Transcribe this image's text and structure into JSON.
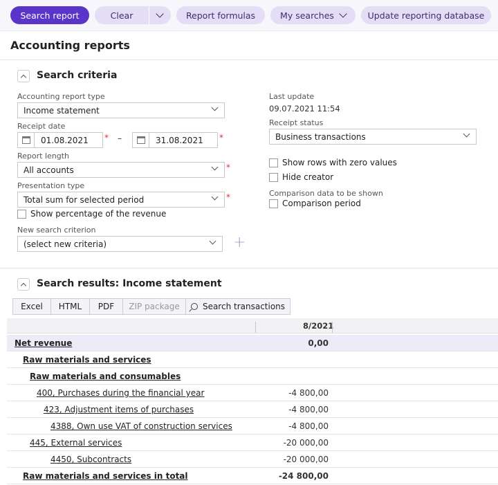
{
  "toolbar": {
    "search_report": "Search report",
    "clear": "Clear",
    "report_formulas": "Report formulas",
    "my_searches": "My searches",
    "update_db": "Update reporting database"
  },
  "page_title": "Accounting reports",
  "criteria": {
    "title": "Search criteria",
    "report_type_label": "Accounting report type",
    "report_type_value": "Income statement",
    "receipt_date_label": "Receipt date",
    "date_from": "01.08.2021",
    "date_to": "31.08.2021",
    "date_separator": "–",
    "report_length_label": "Report length",
    "report_length_value": "All accounts",
    "presentation_label": "Presentation type",
    "presentation_value": "Total sum for selected period",
    "show_percentage": "Show percentage of the revenue",
    "new_criterion_label": "New search criterion",
    "new_criterion_value": "(select new criteria)",
    "last_update_label": "Last update",
    "last_update_value": "09.07.2021 11:54",
    "receipt_status_label": "Receipt status",
    "receipt_status_value": "Business transactions",
    "show_zero_rows": "Show rows with zero values",
    "hide_creator": "Hide creator",
    "comparison_label": "Comparison data to be shown",
    "comparison_period": "Comparison period",
    "required_mark": "*",
    "add_glyph": "+"
  },
  "results": {
    "title": "Search results: Income statement",
    "exports": [
      "Excel",
      "HTML",
      "PDF",
      "ZIP package",
      "Search transactions"
    ],
    "column_header": "8/2021",
    "rows": [
      {
        "name": "Net revenue",
        "value": "0,00"
      },
      {
        "name": "Raw materials and services",
        "value": ""
      },
      {
        "name": "Raw materials and consumables",
        "value": ""
      },
      {
        "name": "400, Purchases during the financial year",
        "value": "-4 800,00"
      },
      {
        "name": "423, Adjustment items of purchases",
        "value": "-4 800,00"
      },
      {
        "name": "4388, Own use VAT of construction services",
        "value": "-4 800,00"
      },
      {
        "name": "445, External services",
        "value": "-20 000,00"
      },
      {
        "name": "4450, Subcontracts",
        "value": "-20 000,00"
      },
      {
        "name": "Raw materials and services in total",
        "value": "-24 800,00"
      }
    ]
  }
}
